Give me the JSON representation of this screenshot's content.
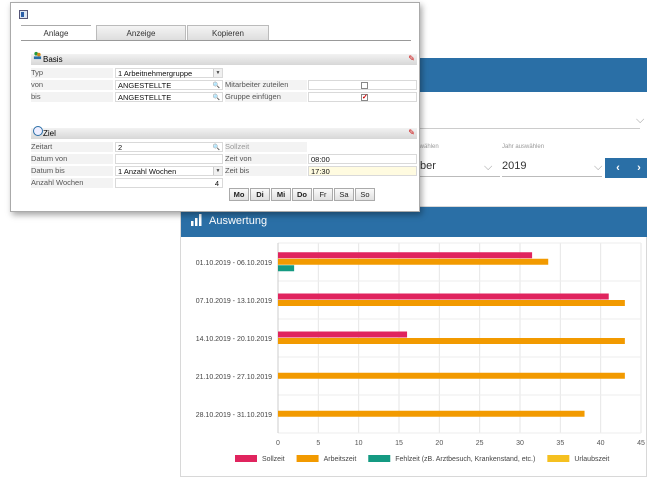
{
  "background": {
    "label_month": "auswählen",
    "month_value": "ber",
    "label_year": "Jahr auswählen",
    "year_value": "2019",
    "prev_glyph": "‹",
    "next_glyph": "›"
  },
  "dialog": {
    "tabs": [
      "Anlage",
      "Anzeige",
      "Kopieren"
    ],
    "basis": {
      "title": "Basis",
      "typ_label": "Typ",
      "typ_value": "1 Arbeitnehmergruppe",
      "von_label": "von",
      "von_value": "ANGESTELLTE",
      "bis_label": "bis",
      "bis_value": "ANGESTELLTE",
      "mitarbeiter_label": "Mitarbeiter zuteilen",
      "mitarbeiter_checked": false,
      "gruppe_label": "Gruppe einfügen",
      "gruppe_checked": true
    },
    "ziel": {
      "title": "Ziel",
      "zeitart_label": "Zeitart",
      "zeitart_value": "2",
      "sollzeit_label": "Sollzeit",
      "datum_von_label": "Datum von",
      "datum_von_value": "",
      "zeit_von_label": "Zeit von",
      "zeit_von_value": "08:00",
      "datum_bis_label": "Datum bis",
      "datum_bis_value": "1 Anzahl Wochen",
      "zeit_bis_label": "Zeit bis",
      "zeit_bis_value": "17:30",
      "anzahl_label": "Anzahl Wochen",
      "anzahl_value": "4"
    },
    "days": [
      {
        "label": "Mo",
        "selected": true
      },
      {
        "label": "Di",
        "selected": true
      },
      {
        "label": "Mi",
        "selected": true
      },
      {
        "label": "Do",
        "selected": true
      },
      {
        "label": "Fr",
        "selected": false
      },
      {
        "label": "Sa",
        "selected": false
      },
      {
        "label": "So",
        "selected": false
      }
    ]
  },
  "chart_panel": {
    "title": "Auswertung"
  },
  "chart_data": {
    "type": "bar",
    "orientation": "horizontal",
    "categories": [
      "01.10.2019 - 06.10.2019",
      "07.10.2019 - 13.10.2019",
      "14.10.2019 - 20.10.2019",
      "21.10.2019 - 27.10.2019",
      "28.10.2019 - 31.10.2019"
    ],
    "series": [
      {
        "name": "Sollzeit",
        "color": "#e0245e",
        "values": [
          31.5,
          41,
          16,
          0,
          0
        ]
      },
      {
        "name": "Arbeitszeit",
        "color": "#f29a00",
        "values": [
          33.5,
          43,
          43,
          43,
          38
        ]
      },
      {
        "name": "Fehlzeit (zB. Arztbesuch, Krankenstand, etc.)",
        "color": "#149a82",
        "values": [
          2,
          0,
          0,
          0,
          0
        ]
      },
      {
        "name": "Urlaubszeit",
        "color": "#f5c020",
        "values": [
          0,
          0,
          0,
          0,
          0
        ]
      }
    ],
    "x_ticks": [
      0,
      5,
      10,
      15,
      20,
      25,
      30,
      35,
      40,
      45
    ],
    "xlim": [
      0,
      45
    ],
    "grid": true,
    "legend_position": "bottom"
  }
}
